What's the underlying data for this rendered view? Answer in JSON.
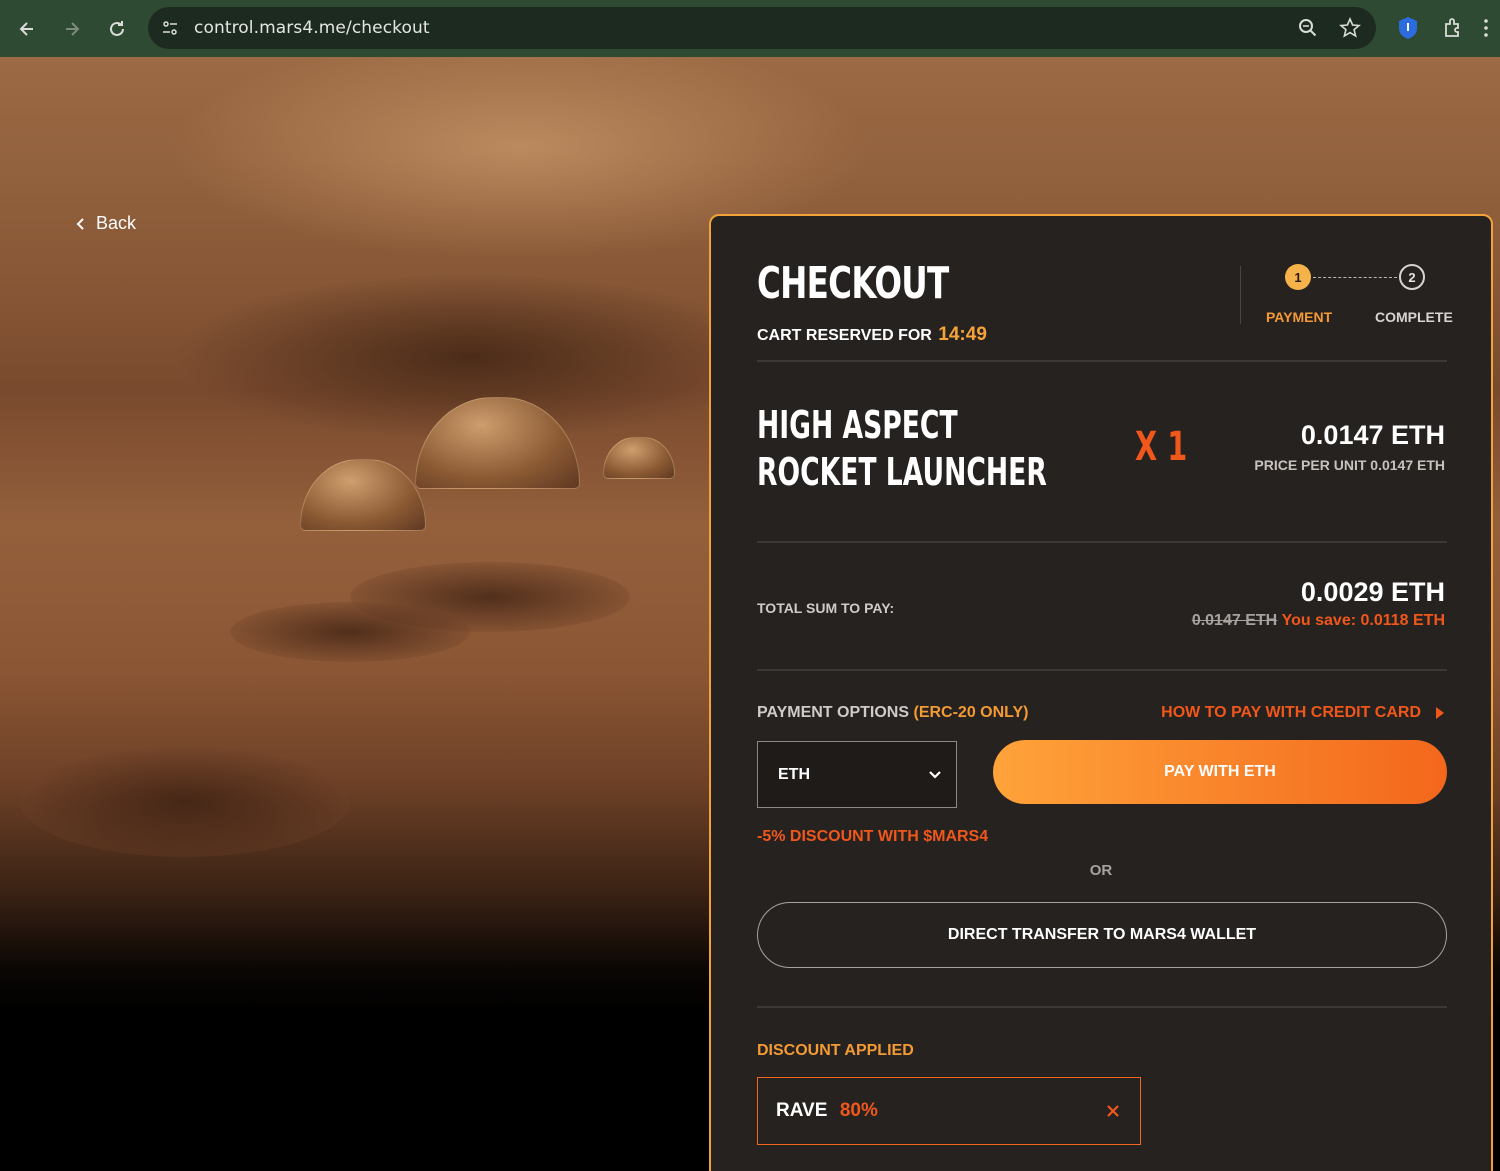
{
  "browser": {
    "url": "control.mars4.me/checkout"
  },
  "back_label": "Back",
  "checkout": {
    "title": "CHECKOUT",
    "reserved_label": "CART RESERVED FOR",
    "reserved_timer": "14:49",
    "steps": [
      {
        "number": "1",
        "label": "PAYMENT"
      },
      {
        "number": "2",
        "label": "COMPLETE"
      }
    ],
    "product": {
      "name": "HIGH ASPECT ROCKET LAUNCHER",
      "quantity": "X 1",
      "price": "0.0147 ETH",
      "unit_price": "PRICE PER UNIT 0.0147 ETH"
    },
    "total": {
      "label": "TOTAL SUM TO PAY:",
      "amount": "0.0029 ETH",
      "old_amount": "0.0147 ETH",
      "savings": "You save: 0.0118 ETH"
    },
    "payment": {
      "options_label": "PAYMENT OPTIONS",
      "options_note": "(ERC-20 ONLY)",
      "howto_label": "HOW TO PAY WITH CREDIT CARD",
      "currency_selected": "ETH",
      "pay_button": "PAY WITH ETH",
      "discount_note": "-5% DISCOUNT WITH $MARS4",
      "or_label": "OR",
      "transfer_button": "DIRECT TRANSFER TO MARS4 WALLET"
    },
    "discount": {
      "label": "DISCOUNT APPLIED",
      "code": "RAVE",
      "percent": "80%"
    }
  },
  "colors": {
    "accent_orange": "#f39a34",
    "accent_red": "#f0571b",
    "panel_bg": "#262220"
  }
}
